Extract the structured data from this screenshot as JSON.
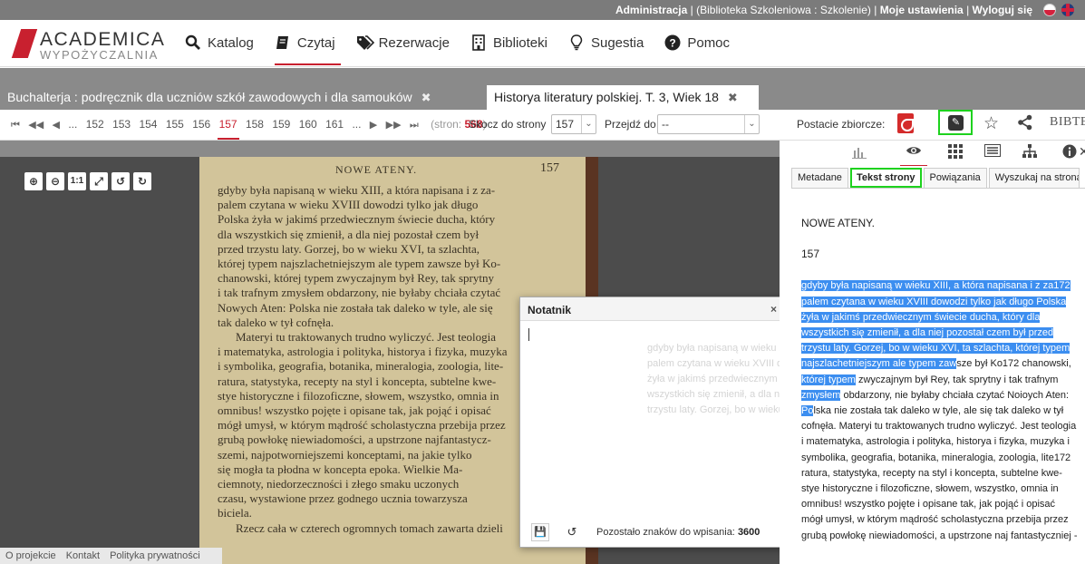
{
  "topbar": {
    "admin": "Administracja",
    "context": "(Biblioteka Szkoleniowa : Szkolenie)",
    "settings": "Moje ustawienia",
    "logout": "Wyloguj się",
    "sep": "|"
  },
  "logo": {
    "top": "ACADEMICA",
    "bottom": "WYPOŻYCZALNIA"
  },
  "nav": [
    {
      "label": "Katalog",
      "icon": "search-icon"
    },
    {
      "label": "Czytaj",
      "icon": "book-icon"
    },
    {
      "label": "Rezerwacje",
      "icon": "tag-icon"
    },
    {
      "label": "Biblioteki",
      "icon": "building-icon"
    },
    {
      "label": "Sugestia",
      "icon": "lightbulb-icon"
    },
    {
      "label": "Pomoc",
      "icon": "help-icon"
    }
  ],
  "tabs": [
    {
      "label": "Buchalterja : podręcznik dla uczniów szkół zawodowych i dla samouków",
      "close": "✖"
    },
    {
      "label": "Historya literatury polskiej. T. 3, Wiek 18",
      "close": "✖"
    }
  ],
  "pager": {
    "pages": [
      "152",
      "153",
      "154",
      "155",
      "156",
      "157",
      "158",
      "159",
      "160",
      "161"
    ],
    "current": "157",
    "ellipsis": "...",
    "count_prefix": "(stron:",
    "count": "568",
    "count_suffix": ")"
  },
  "jump": {
    "label": "Skocz do strony",
    "value": "157"
  },
  "goto": {
    "label": "Przejdź do",
    "value": "--"
  },
  "aggregate_label": "Postacie zbiorcze:",
  "bibtex": "BIBTEX",
  "scan": {
    "running_head": "NOWE ATENY.",
    "page_number": "157",
    "lines": [
      "gdyby była napisaną w wieku XIII, a która napisana i z za-",
      "palem czytana w wieku XVIII dowodzi tylko jak długo",
      "Polska żyła w jakimś przedwiecznym świecie ducha, który",
      "dla wszystkich się zmienił, a dla niej pozostał czem był",
      "przed trzystu laty. Gorzej, bo w wieku XVI, ta szlachta,",
      "której typem najszlachetniejszym ale typem zawsze był Ko-",
      "chanowski, której typem zwyczajnym był Rey, tak sprytny",
      "i tak trafnym zmysłem obdarzony, nie byłaby chciała czytać",
      "Nowych Aten: Polska nie została tak daleko w tyle, ale się",
      "tak daleko w tył cofnęła.",
      "Materyi tu traktowanych trudno wyliczyć. Jest teologia",
      "i matematyka, astrologia i polityka, historya i fizyka, muzyka",
      "i symbolika, geografia, botanika, mineralogia, zoologia, lite-",
      "ratura, statystyka, recepty na styl i koncepta, subtelne kwe-",
      "stye historyczne i filozoficzne, słowem, wszystko, omnia in",
      "omnibus! wszystko pojęte i opisane tak, jak pojąć i opisać",
      "mógł umysł, w którym mądrość scholastyczna przebija przez",
      "grubą powłokę niewiadomości, a upstrzone najfantastycz-",
      "szemi, najpotworniejszemi konceptami, na jakie tylko",
      "się mogła ta płodna w koncepta epoka. Wielkie Ma-",
      "ciemnoty, niedorzeczności i złego smaku uczonych",
      "czasu, wystawione przez godnego ucznia towarzysza",
      "biciela.",
      "Rzecz cała w czterech ogromnych tomach zawarta dzieli"
    ]
  },
  "footer": [
    "O projekcie",
    "Kontakt",
    "Polityka prywatności"
  ],
  "notes": {
    "title": "Notatnik",
    "close": "×",
    "ghost_lines": [
      "gdyby była napisaną w wieku XIII, a",
      "palem czytana w wieku XVIII dowodzi",
      "żyła w jakimś przedwiecznym świecie",
      "wszystkich się zmienił, a dla niej poz",
      "trzystu laty. Gorzej, bo w wieku XVI,"
    ],
    "remaining_label": "Pozostało znaków do wpisania:",
    "remaining": "3600"
  },
  "right_panel": {
    "tabs": [
      "Metadane",
      "Tekst strony",
      "Powiązania",
      "Wyszukaj na stronach"
    ],
    "active_tab": "Tekst strony",
    "heading": "NOWE ATENY.",
    "page": "157",
    "highlighted_lines": [
      "gdyby była napisaną w wieku XIII, a która napisana i z za172",
      "palem czytana w wieku XVIII dowodzi tylko jak długo Polska",
      "żyła w jakimś przedwiecznym świecie ducha, który dla",
      "wszystkich się zmienił, a dla niej pozostał czem był przed",
      "trzystu laty. Gorzej, bo w wieku XVI, ta szlachta, której typem",
      "najszlachetniejszym ale typem zaw"
    ],
    "line6_rest": "sze był Ko172 chanowski,",
    "line7_hl": "której typem",
    "line7_rest": " zwyczajnym był Rey, tak sprytny i tak trafnym",
    "line8_hl": "zmysłem",
    "line8_rest": " obdarzony, nie byłaby chciała czytać Noioych Aten:",
    "line9_hl": "Po",
    "line9_rest": "lska nie została tak daleko w tyle, ale się tak daleko w tył",
    "plain_lines": [
      "cofnęła. Materyi tu traktowanych trudno wyliczyć. Jest teologia",
      "i matematyka, astrologia i polityka, historya i fizyka, muzyka i",
      "symbolika, geografia, botanika, mineralogia, zoologia, lite172",
      "ratura, statystyka, recepty na styl i koncepta, subtelne kwe-",
      "stye historyczne i filozoficzne, słowem, wszystko, omnia in",
      "omnibus! wszystko pojęte i opisane tak, jak pojąć i opisać",
      "mógł umysł, w którym mądrość scholastyczna przebija przez",
      "grubą powłokę niewiadomości, a upstrzone naj fantastyczniej -"
    ]
  },
  "colors": {
    "accent": "#c8202f",
    "highlight": "#3c8ef0",
    "focus_outline": "#1ed21e"
  }
}
